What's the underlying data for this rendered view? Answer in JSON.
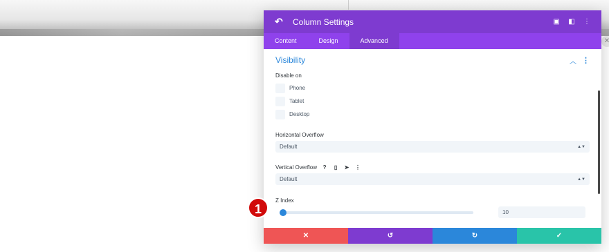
{
  "modal": {
    "title": "Column Settings",
    "back_icon": "back-arrow-icon",
    "header_icons": [
      "focus-icon",
      "columns-layout-icon",
      "more-vertical-icon"
    ],
    "colors": {
      "header": "#7e3bd0",
      "tabs": "#8f42ec",
      "accent": "#2b87da"
    }
  },
  "tabs": [
    {
      "label": "Content",
      "active": false
    },
    {
      "label": "Design",
      "active": false
    },
    {
      "label": "Advanced",
      "active": true
    }
  ],
  "visibility": {
    "title": "Visibility",
    "disable_on_label": "Disable on",
    "devices": [
      {
        "label": "Phone",
        "checked": false
      },
      {
        "label": "Tablet",
        "checked": false
      },
      {
        "label": "Desktop",
        "checked": false
      }
    ],
    "horizontal_overflow": {
      "label": "Horizontal Overflow",
      "value": "Default"
    },
    "vertical_overflow": {
      "label": "Vertical Overflow",
      "value": "Default"
    },
    "z_index": {
      "label": "Z Index",
      "value": "10",
      "slider_fraction": 0.0
    }
  },
  "footer": {
    "colors": {
      "cancel": "#ef5555",
      "undo": "#7e3bd0",
      "redo": "#2b87da",
      "save": "#29c4a9"
    },
    "icons": [
      "close-icon",
      "undo-icon",
      "redo-icon",
      "check-icon"
    ]
  },
  "marker": {
    "label": "1",
    "color": "#d10a0a"
  }
}
